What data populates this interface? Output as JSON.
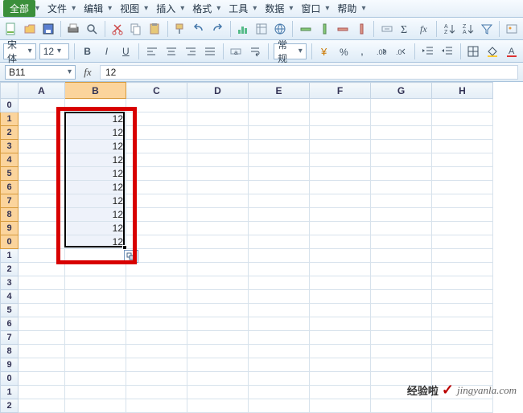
{
  "menu": {
    "items": [
      "全部",
      "文件",
      "编辑",
      "视图",
      "插入",
      "格式",
      "工具",
      "数据",
      "窗口",
      "帮助"
    ]
  },
  "toolbar1": {
    "icons": [
      "new-doc-icon",
      "open-icon",
      "save-icon",
      "print-icon",
      "print-preview-icon",
      "cut-icon",
      "copy-icon",
      "paste-icon",
      "sort-asc-icon",
      "sort-desc-icon",
      "chart-icon",
      "pivot-icon",
      "autofilter-icon",
      "insert-rows-icon",
      "delete-rows-icon",
      "freeze-icon",
      "autosum-icon",
      "sigma-icon",
      "function-icon",
      "sort-az-icon",
      "sort-za-icon",
      "filter-icon"
    ]
  },
  "toolbar2": {
    "font_name": "宋体",
    "font_size": "12",
    "number_format": "常规",
    "icons": [
      "bold-icon",
      "italic-icon",
      "underline-icon",
      "align-left-icon",
      "align-center-icon",
      "align-right-icon",
      "merge-icon",
      "wrap-icon",
      "currency-icon",
      "percent-icon",
      "comma-icon",
      "dec-inc-icon",
      "dec-dec-icon",
      "indent-dec-icon",
      "indent-inc-icon",
      "border-icon",
      "fill-color-icon",
      "font-color-icon"
    ]
  },
  "namebox": {
    "value": "B11"
  },
  "formula": {
    "fx_label": "fx",
    "value": "12"
  },
  "columns": [
    "A",
    "B",
    "C",
    "D",
    "E",
    "F",
    "G",
    "H"
  ],
  "col_widths": [
    "colA",
    "colOther",
    "colOther",
    "colOther",
    "colOther",
    "colOther",
    "colOther",
    "colOther"
  ],
  "rows": [
    0,
    1,
    2,
    3,
    4,
    5,
    6,
    7,
    8,
    9,
    0,
    1,
    2,
    3,
    4,
    5,
    6,
    7,
    8,
    9,
    0,
    1,
    2
  ],
  "selected_col_index": 1,
  "selected_row_start": 1,
  "selected_row_end": 10,
  "cell_data": {
    "B": {
      "1": "12",
      "2": "12",
      "3": "12",
      "4": "12",
      "5": "12",
      "6": "12",
      "7": "12",
      "8": "12",
      "9": "12",
      "10": "12"
    }
  },
  "watermark": {
    "cn": "经验啦",
    "url": "jingyanla.com",
    "mark": "✓"
  }
}
